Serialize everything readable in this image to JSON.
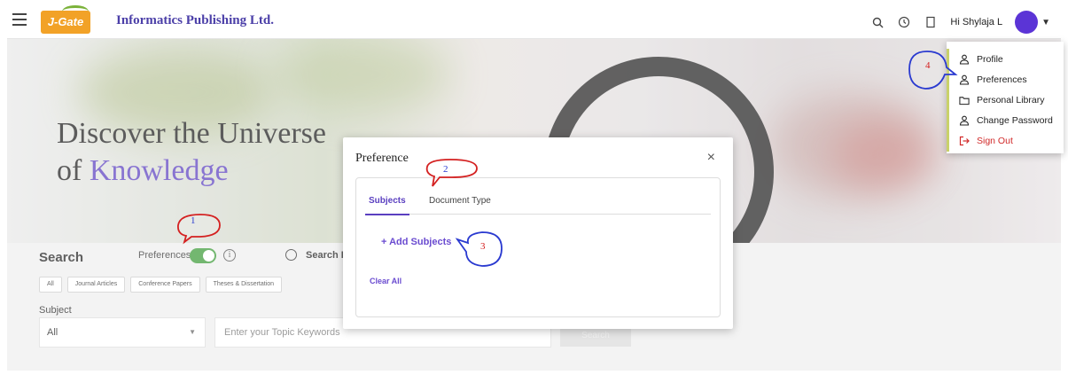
{
  "header": {
    "logo_text": "J-Gate",
    "org_name": "Informatics Publishing Ltd.",
    "greeting": "Hi Shylaja L",
    "icons": [
      "menu-icon",
      "search-icon",
      "history-icon",
      "bookmark-icon",
      "avatar",
      "chevron-down-icon"
    ]
  },
  "hero": {
    "title_line1": "Discover the Universe",
    "title_line2_prefix": "of ",
    "title_line2_accent": "Knowledge"
  },
  "search": {
    "label": "Search",
    "preferences_label": "Preferences",
    "search_by_label": "Search B",
    "chips": [
      "All",
      "Journal Articles",
      "Conference Papers",
      "Theses & Dissertation"
    ],
    "subject_label": "Subject",
    "subject_value": "All",
    "keyword_placeholder": "Enter your Topic Keywords",
    "search_button": "Search"
  },
  "modal": {
    "title": "Preference",
    "close": "×",
    "tabs": [
      "Subjects",
      "Document Type"
    ],
    "add_subjects": "+ Add Subjects",
    "clear_all": "Clear All"
  },
  "user_menu": {
    "items": [
      "Profile",
      "Preferences",
      "Personal Library",
      "Change Password",
      "Sign Out"
    ]
  },
  "annotations": [
    "1",
    "2",
    "3",
    "4"
  ],
  "colors": {
    "accent": "#5a3fc0",
    "toggle_on": "#3e9c3a",
    "sign_out": "#d12a2a",
    "logo_bg": "#f2a227",
    "annotation_red": "#d42020",
    "annotation_blue": "#2a3ad0"
  }
}
